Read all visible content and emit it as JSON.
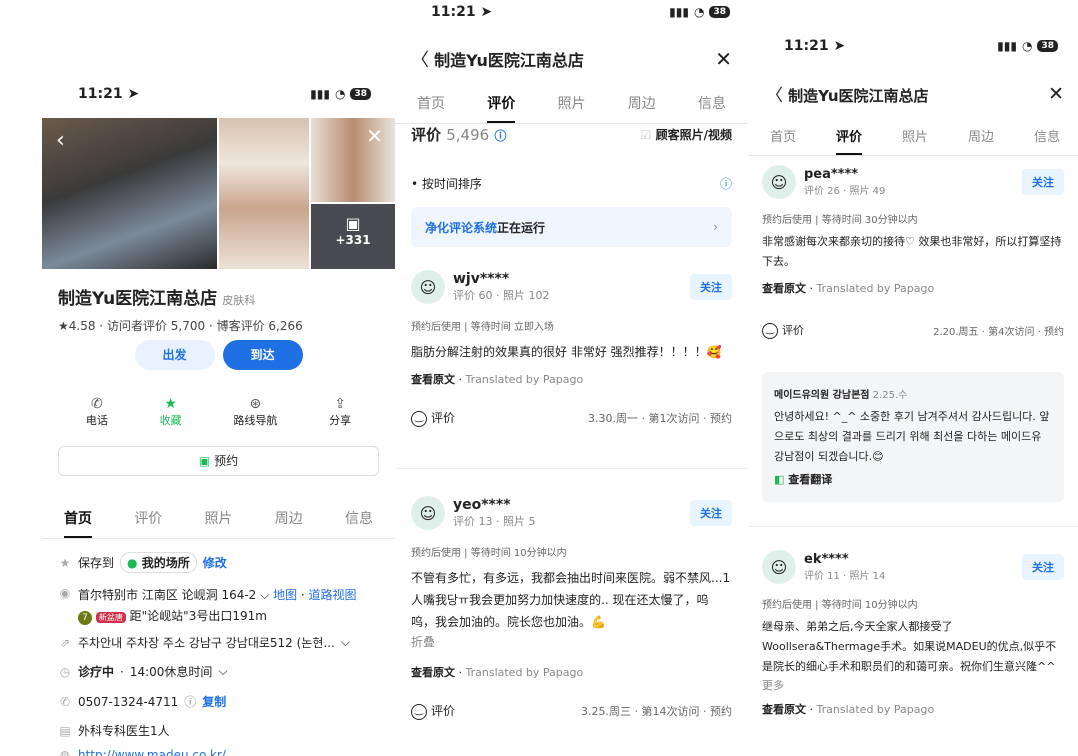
{
  "status": {
    "time": "11:21",
    "battery": "38"
  },
  "p1": {
    "place_name": "制造Yu医院江南总店",
    "category": "皮肤科",
    "rating": "★4.58",
    "visitor_reviews": "访问者评价 5,700",
    "blog_reviews": "博客评价 6,266",
    "photo_count": "+331",
    "btn_depart": "出发",
    "btn_arrive": "到达",
    "actions": [
      "电话",
      "收藏",
      "路线导航",
      "分享"
    ],
    "reserve": "预约",
    "tabs": [
      "首页",
      "评价",
      "照片",
      "周边",
      "信息"
    ],
    "save_to": "保存到",
    "my_place": "我的场所",
    "edit": "修改",
    "address": "首尔特别市 江南区 论岘洞 164-2",
    "map_link": "地图",
    "road_link": "道路视图",
    "subway_num": "7",
    "subway_line": "新盆唐",
    "subway_dist": "距\"论岘站\"3号出口191m",
    "parking": "주차안내 주차장 주소 강남구 강남대로512 (논현...",
    "hours_status": "诊疗中",
    "hours": "14:00休息时间",
    "phone": "0507-1324-4711",
    "copy": "复制",
    "doctor": "外科专科医生1人",
    "url": "http://www.madeu.co.kr/"
  },
  "p2": {
    "title": "制造Yu医院江南总店",
    "tabs": [
      "首页",
      "评价",
      "照片",
      "周边",
      "信息"
    ],
    "review_label": "评价",
    "review_count": "5,496",
    "filter_label": "顾客照片/视频",
    "sort_label": "• 按时间排序",
    "banner_bold": "净化评论系统",
    "banner_rest": "正在运行",
    "follow": "关注",
    "translate_view": "查看原文",
    "translate_by": "Translated by Papago",
    "rate_label": "评价",
    "reviews": [
      {
        "user": "wjv****",
        "meta": "评价 60 · 照片 102",
        "info": "预约后使用 | 等待时间 立即入场",
        "text": "脂肪分解注射的效果真的很好 非常好 强烈推荐！！！！🥰",
        "visit": "3.30.周一 · 第1次访问 · 预约"
      },
      {
        "user": "yeo****",
        "meta": "评价 13 · 照片 5",
        "info": "预约后使用 | 等待时间 10分钟以内",
        "text": "不管有多忙，有多远，我都会抽出时间来医院。弱不禁风...1人嘴我당ㅠ我会更加努力加快速度的.. 现在还太慢了，呜呜，我会加油的。院长您也加油。💪",
        "more": "折叠",
        "visit": "3.25.周三 · 第14次访问 · 预约"
      }
    ]
  },
  "p3": {
    "title": "制造Yu医院江南总店",
    "tabs": [
      "首页",
      "评价",
      "照片",
      "周边",
      "信息"
    ],
    "follow": "关注",
    "translate_view": "查看原文",
    "translate_by": "Translated by Papago",
    "rate_label": "评价",
    "r1": {
      "user": "pea****",
      "meta": "评价 26 · 照片 49",
      "info": "预约后使用 | 等待时间 30分钟以内",
      "text": "非常感谢每次来都亲切的接待♡ 效果也非常好，所以打算坚持下去。",
      "visit": "2.20.周五 · 第4次访问 · 预约"
    },
    "reply": {
      "name": "메이드유의원 강남본점",
      "date": "2.25.수",
      "text": "안녕하세요! ^_^ 소중한 후기 남겨주셔서 감사드립니다. 앞으로도 최상의 결과를 드리기 위해 최선을 다하는 메이드유 강남점이 되겠습니다.😊",
      "translate": "查看翻译"
    },
    "r2": {
      "user": "ek****",
      "meta": "评价 11 · 照片 14",
      "info": "预约后使用 | 等待时间 10分钟以内",
      "text": "继母亲、弟弟之后,今天全家人都接受了Woollsera&Thermage手术。如果说MADEU的优点,似乎不是院长的细心手术和职员们的和蔼可亲。祝你们生意兴隆^^",
      "more": "更多"
    }
  }
}
